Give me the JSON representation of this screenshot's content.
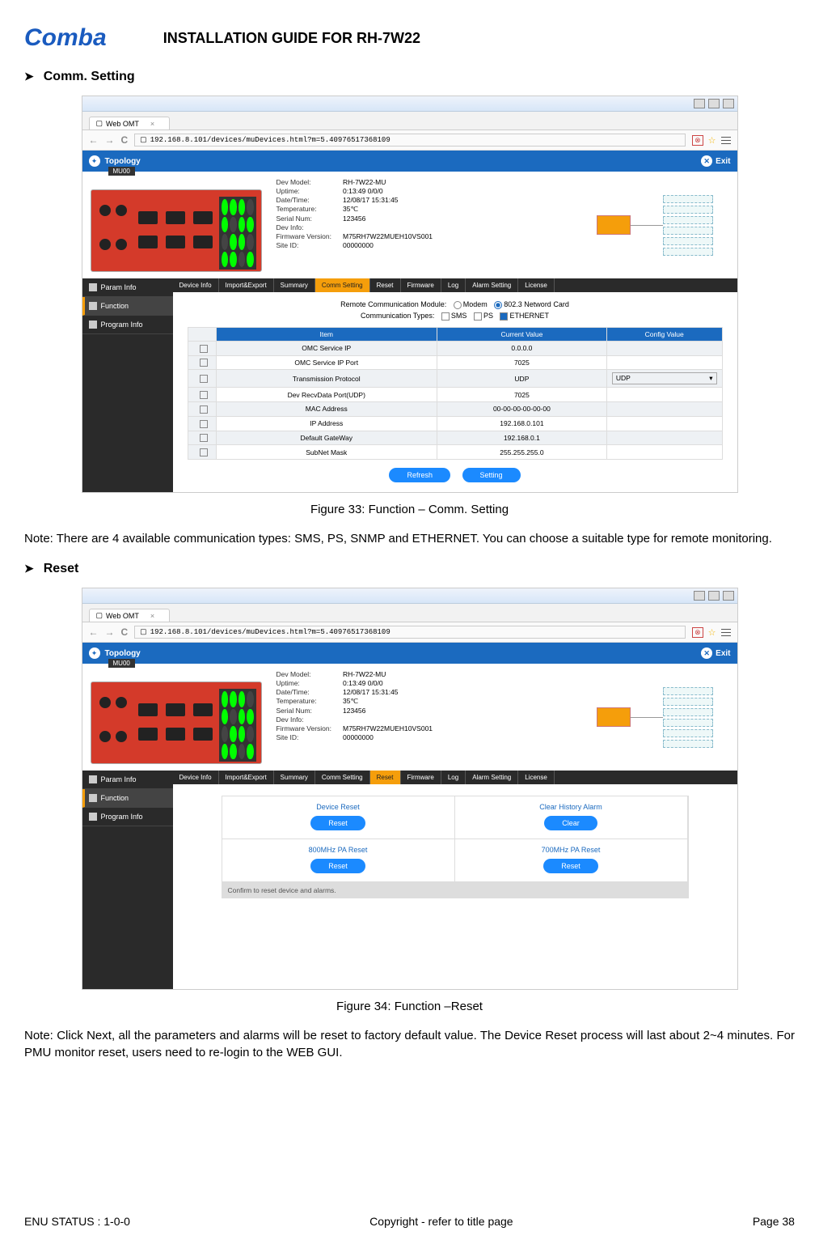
{
  "header": {
    "logo_text": "Comba",
    "doc_title": "INSTALLATION GUIDE FOR RH-7W22"
  },
  "section1": {
    "heading": "Comm. Setting",
    "caption": "Figure 33: Function – Comm. Setting",
    "note": "Note: There are 4 available communication types: SMS, PS, SNMP and ETHERNET. You can choose a suitable type for remote monitoring."
  },
  "section2": {
    "heading": "Reset",
    "caption": "Figure 34: Function –Reset",
    "note": "Note: Click Next, all the parameters and alarms will be reset to factory default value. The Device Reset process will last about 2~4 minutes. For PMU monitor reset, users need to re-login to the WEB GUI."
  },
  "browser": {
    "tab_title": "Web OMT",
    "url": "192.168.8.101/devices/muDevices.html?m=5.40976517368109"
  },
  "app": {
    "topology": "Topology",
    "exit": "Exit",
    "device_label": "MU00",
    "dev_info": {
      "model_k": "Dev Model:",
      "model_v": "RH-7W22-MU",
      "uptime_k": "Uptime:",
      "uptime_v": "0:13:49 0/0/0",
      "datetime_k": "Date/Time:",
      "datetime_v": "12/08/17 15:31:45",
      "temp_k": "Temperature:",
      "temp_v": "35℃",
      "serial_k": "Serial Num:",
      "serial_v": "123456",
      "devinfo_k": "Dev Info:",
      "devinfo_v": "",
      "fw_k": "Firmware Version:",
      "fw_v": "M75RH7W22MUEH10VS001",
      "site_k": "Site ID:",
      "site_v": "00000000"
    },
    "sidebar": {
      "param": "Param Info",
      "function": "Function",
      "program": "Program Info"
    },
    "tabs": {
      "devinfo": "Device Info",
      "impexp": "Import&Export",
      "summary": "Summary",
      "comm": "Comm Setting",
      "reset": "Reset",
      "firmware": "Firmware",
      "log": "Log",
      "alarm": "Alarm Setting",
      "license": "License"
    }
  },
  "comm": {
    "mode_label": "Remote Communication Module:",
    "mode_modem": "Modem",
    "mode_netcard": "802.3 Netword Card",
    "types_label": "Communication Types:",
    "type_sms": "SMS",
    "type_ps": "PS",
    "type_eth": "ETHERNET",
    "col_item": "Item",
    "col_current": "Current Value",
    "col_config": "Config Value",
    "rows": [
      {
        "item": "OMC Service IP",
        "current": "0.0.0.0",
        "config": "",
        "alt": true
      },
      {
        "item": "OMC Service IP Port",
        "current": "7025",
        "config": ""
      },
      {
        "item": "Transmission Protocol",
        "current": "UDP",
        "config": "UDP",
        "select": true,
        "alt": true
      },
      {
        "item": "Dev RecvData Port(UDP)",
        "current": "7025",
        "config": ""
      },
      {
        "item": "MAC Address",
        "current": "00-00-00-00-00-00",
        "config": "",
        "alt": true
      },
      {
        "item": "IP Address",
        "current": "192.168.0.101",
        "config": ""
      },
      {
        "item": "Default GateWay",
        "current": "192.168.0.1",
        "config": "",
        "alt": true
      },
      {
        "item": "SubNet Mask",
        "current": "255.255.255.0",
        "config": ""
      }
    ],
    "btn_refresh": "Refresh",
    "btn_setting": "Setting"
  },
  "reset": {
    "cells": [
      {
        "label": "Device Reset",
        "btn": "Reset"
      },
      {
        "label": "Clear History Alarm",
        "btn": "Clear"
      },
      {
        "label": "800MHz PA Reset",
        "btn": "Reset"
      },
      {
        "label": "700MHz PA Reset",
        "btn": "Reset"
      }
    ],
    "confirm": "Confirm to reset device and alarms."
  },
  "footer": {
    "left": "ENU STATUS : 1-0-0",
    "center": "Copyright - refer to title page",
    "right": "Page 38"
  }
}
